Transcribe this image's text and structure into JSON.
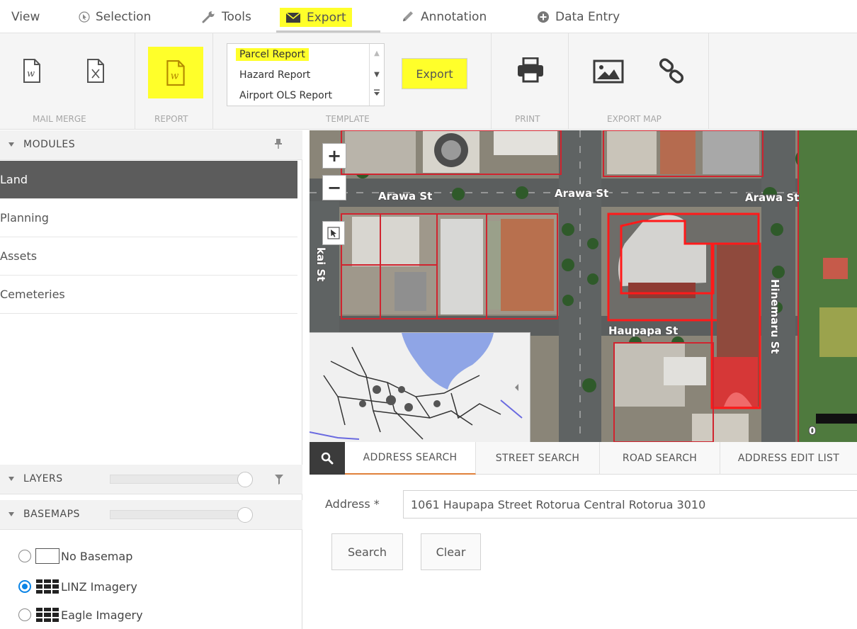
{
  "menu": {
    "view": "View",
    "selection": "Selection",
    "tools": "Tools",
    "export": "Export",
    "annotation": "Annotation",
    "data_entry": "Data Entry"
  },
  "ribbon": {
    "mail_merge_label": "MAIL MERGE",
    "report_label": "REPORT",
    "template_label": "TEMPLATE",
    "print_label": "PRINT",
    "export_map_label": "EXPORT MAP",
    "templates": [
      "Parcel Report",
      "Hazard Report",
      "Airport OLS Report"
    ],
    "selected_template": "Parcel Report",
    "export_button": "Export",
    "highlight_color": "#ffff2a"
  },
  "modules": {
    "title": "MODULES",
    "items": [
      "Land",
      "Planning",
      "Assets",
      "Cemeteries"
    ],
    "selected": "Land"
  },
  "layers": {
    "title": "LAYERS"
  },
  "basemaps": {
    "title": "BASEMAPS",
    "options": [
      "No Basemap",
      "LINZ Imagery",
      "Eagle Imagery"
    ],
    "selected": "LINZ Imagery"
  },
  "map": {
    "zoom_in": "+",
    "zoom_out": "−",
    "streets": {
      "arawa_1": "Arawa St",
      "arawa_2": "Arawa St",
      "arawa_3": "Arawa St",
      "haupapa": "Haupapa St",
      "hinemaru": "Hinemaru St",
      "tutanekai": "kai St"
    },
    "scale_zero": "0"
  },
  "search": {
    "tabs": [
      "ADDRESS SEARCH",
      "STREET SEARCH",
      "ROAD SEARCH",
      "ADDRESS EDIT LIST"
    ],
    "active_tab": "ADDRESS SEARCH",
    "address_label": "Address *",
    "address_value": "1061 Haupapa Street Rotorua Central Rotorua 3010",
    "search_button": "Search",
    "clear_button": "Clear",
    "accent_color": "#e0803a"
  }
}
